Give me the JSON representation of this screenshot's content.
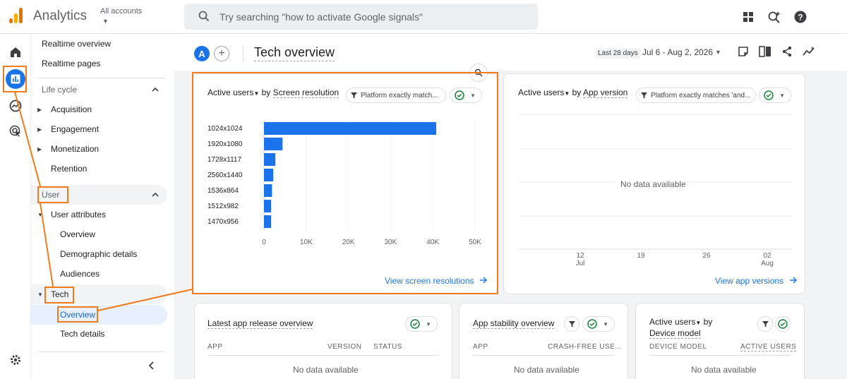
{
  "topbar": {
    "app_title": "Analytics",
    "account_label": "All accounts",
    "search_placeholder": "Try searching \"how to activate Google signals\""
  },
  "nav": {
    "items": [
      {
        "label": "Realtime overview"
      },
      {
        "label": "Realtime pages"
      },
      {
        "label": "Life cycle"
      },
      {
        "label": "Acquisition"
      },
      {
        "label": "Engagement"
      },
      {
        "label": "Monetization"
      },
      {
        "label": "Retention"
      },
      {
        "label": "User"
      },
      {
        "label": "User attributes"
      },
      {
        "label": "Overview"
      },
      {
        "label": "Demographic details"
      },
      {
        "label": "Audiences"
      },
      {
        "label": "Tech"
      },
      {
        "label": "Overview"
      },
      {
        "label": "Tech details"
      }
    ]
  },
  "header": {
    "avatar_letter": "A",
    "add_comparison": "+",
    "title": "Tech overview",
    "date_badge": "Last 28 days",
    "date_range": "Jul 6 - Aug 2, 2026"
  },
  "cards": {
    "screen_resolution": {
      "metric": "Active users",
      "by": "by",
      "dimension": "Screen resolution",
      "filter": "Platform exactly match...",
      "link": "View screen resolutions"
    },
    "app_version": {
      "metric": "Active users",
      "by": "by",
      "dimension": "App version",
      "filter": "Platform exactly matches 'and...",
      "no_data": "No data available",
      "x_ticks": [
        {
          "day": "12",
          "month": "Jul"
        },
        {
          "day": "19",
          "month": ""
        },
        {
          "day": "26",
          "month": ""
        },
        {
          "day": "02",
          "month": "Aug"
        }
      ],
      "link": "View app versions"
    },
    "latest_release": {
      "title": "Latest app release overview",
      "columns": [
        "APP",
        "VERSION",
        "STATUS"
      ],
      "no_data": "No data available"
    },
    "stability": {
      "title": "App stability overview",
      "columns": [
        "APP",
        "CRASH-FREE USE..."
      ],
      "no_data": "No data available"
    },
    "device_model": {
      "metric": "Active users",
      "by": "by",
      "dimension": "Device model",
      "columns": [
        "DEVICE MODEL",
        "ACTIVE USERS"
      ],
      "no_data": "No data available"
    }
  },
  "colors": {
    "accent": "#1a73e8",
    "bar": "#1a73e8",
    "highlight": "#f07b1d",
    "check": "#188038"
  },
  "chart_data": {
    "type": "bar",
    "orientation": "horizontal",
    "categories": [
      "1024x1024",
      "1920x1080",
      "1728x1117",
      "2560x1440",
      "1536x864",
      "1512x982",
      "1470x956"
    ],
    "values": [
      40800,
      4400,
      2700,
      2200,
      1900,
      1700,
      1700
    ],
    "xlim": [
      0,
      50000
    ],
    "x_ticks": [
      "0",
      "10K",
      "20K",
      "30K",
      "40K",
      "50K"
    ],
    "grid": true
  }
}
